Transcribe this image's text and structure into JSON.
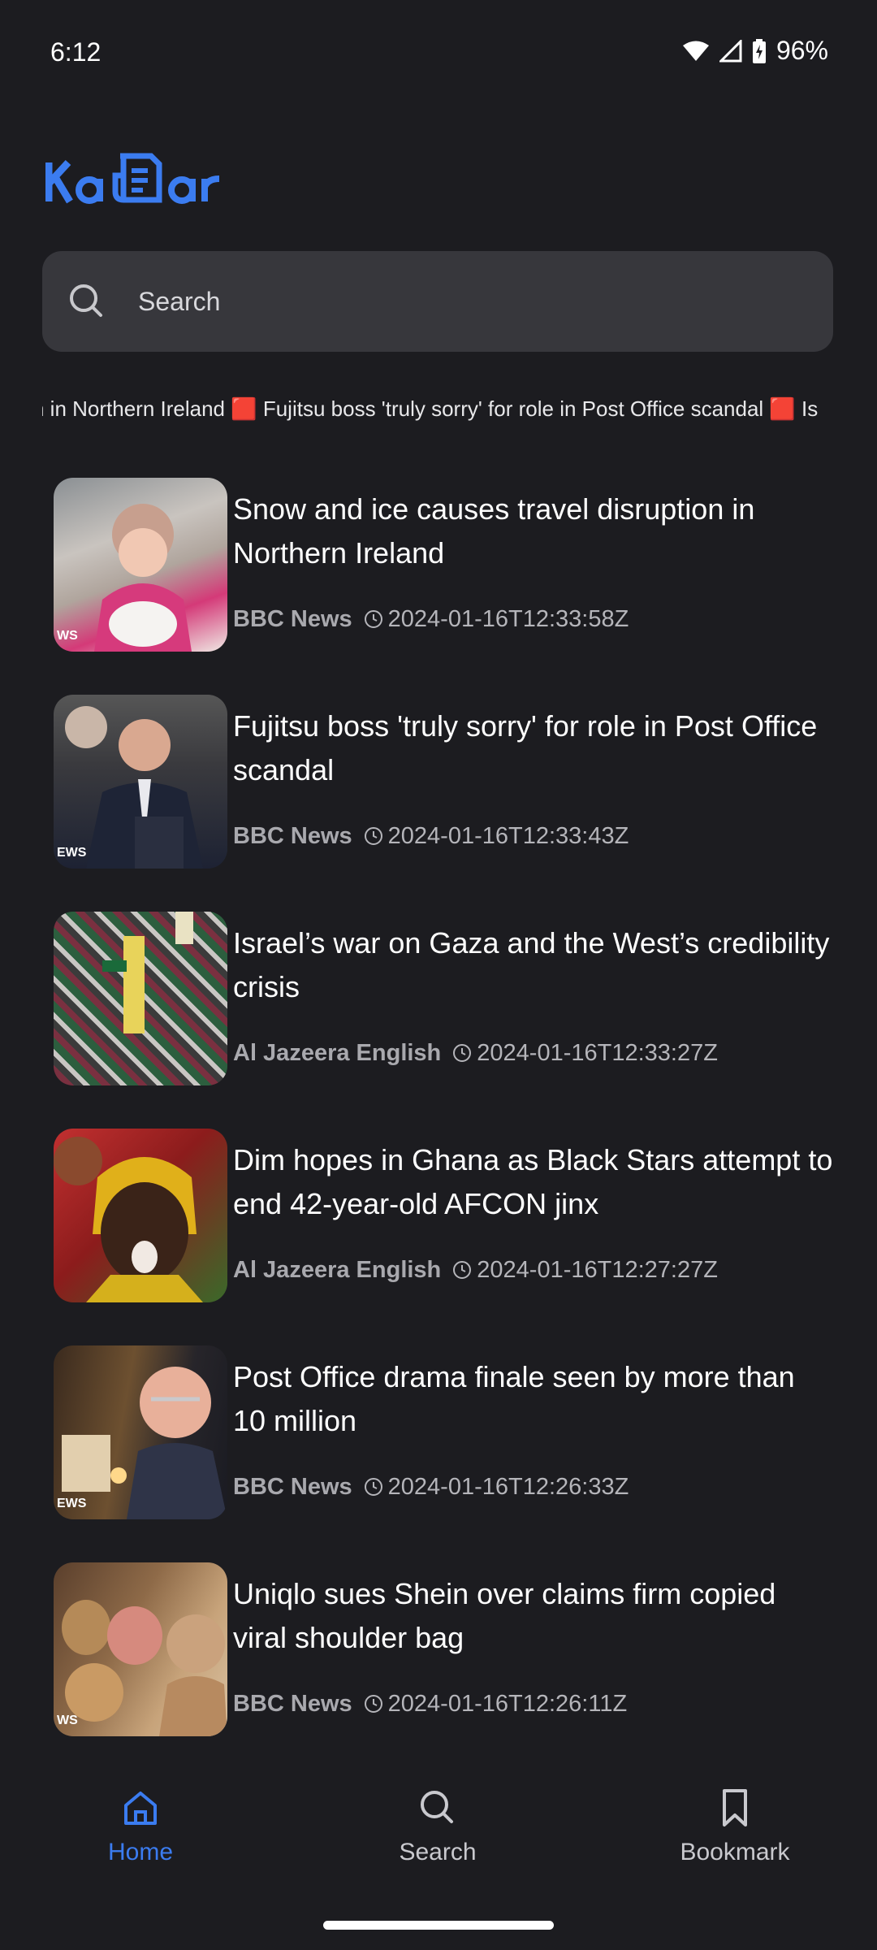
{
  "status": {
    "time": "6:12",
    "battery": "96%"
  },
  "app": {
    "logo_text": "Kabar",
    "brand_color": "#3b7cf0"
  },
  "search": {
    "placeholder": "Search"
  },
  "ticker": {
    "text": "n in Northern Ireland 🟥 Fujitsu boss 'truly sorry' for role in Post Office scandal 🟥 Is"
  },
  "news": [
    {
      "title": "Snow and ice causes travel disruption in Northern Ireland",
      "source": "BBC News",
      "published": "2024-01-16T12:33:58Z",
      "thumb_tag": "WS"
    },
    {
      "title": "Fujitsu boss 'truly sorry' for role in Post Office scandal",
      "source": "BBC News",
      "published": "2024-01-16T12:33:43Z",
      "thumb_tag": "EWS"
    },
    {
      "title": "Israel’s war on Gaza and the West’s credibility crisis",
      "source": "Al Jazeera English",
      "published": "2024-01-16T12:33:27Z",
      "thumb_tag": ""
    },
    {
      "title": "Dim hopes in Ghana as Black Stars attempt to end 42-year-old AFCON jinx",
      "source": "Al Jazeera English",
      "published": "2024-01-16T12:27:27Z",
      "thumb_tag": ""
    },
    {
      "title": "Post Office drama finale seen by more than 10 million",
      "source": "BBC News",
      "published": "2024-01-16T12:26:33Z",
      "thumb_tag": "EWS"
    },
    {
      "title": "Uniqlo sues Shein over claims firm copied viral shoulder bag",
      "source": "BBC News",
      "published": "2024-01-16T12:26:11Z",
      "thumb_tag": "WS"
    }
  ],
  "nav": {
    "home": "Home",
    "search": "Search",
    "bookmark": "Bookmark"
  }
}
